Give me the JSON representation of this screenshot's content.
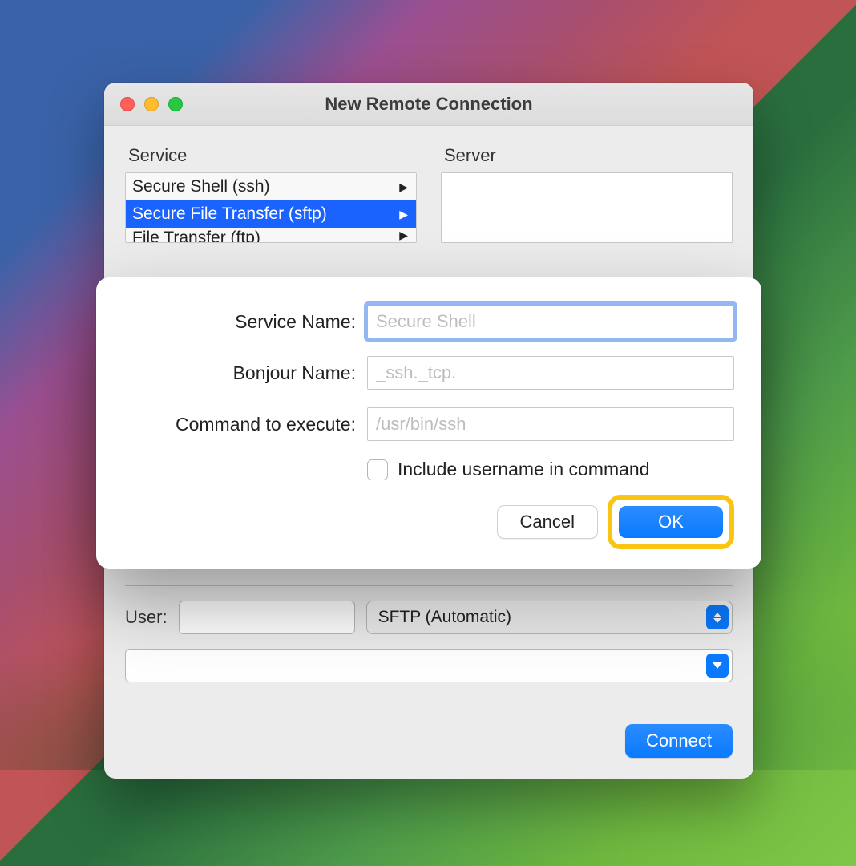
{
  "window": {
    "title": "New Remote Connection",
    "service_label": "Service",
    "server_label": "Server",
    "services": [
      {
        "name": "Secure Shell (ssh)",
        "selected": false
      },
      {
        "name": "Secure File Transfer (sftp)",
        "selected": true
      },
      {
        "name": "File Transfer (ftp)",
        "selected": false
      }
    ],
    "user_label": "User:",
    "user_value": "",
    "protocol_select": "SFTP (Automatic)",
    "address_value": "",
    "connect_label": "Connect"
  },
  "sheet": {
    "fields": {
      "service_name": {
        "label": "Service Name:",
        "placeholder": "Secure Shell",
        "value": ""
      },
      "bonjour_name": {
        "label": "Bonjour Name:",
        "placeholder": "_ssh._tcp.",
        "value": ""
      },
      "command": {
        "label": "Command to execute:",
        "placeholder": "/usr/bin/ssh",
        "value": ""
      }
    },
    "include_username_label": "Include username in command",
    "cancel_label": "Cancel",
    "ok_label": "OK"
  }
}
